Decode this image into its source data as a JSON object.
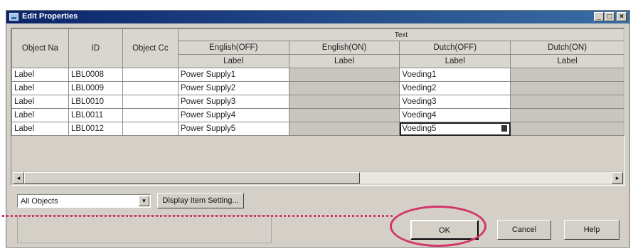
{
  "window": {
    "title": "Edit Properties"
  },
  "titlebar_buttons": [
    "_",
    "□",
    "×"
  ],
  "grid": {
    "col_object_name": "Object Na",
    "col_id": "ID",
    "col_object_comment": "Object Cc",
    "group_text": "Text",
    "lang_headers": [
      "English(OFF)",
      "English(ON)",
      "Dutch(OFF)",
      "Dutch(ON)"
    ],
    "sub_label": "Label",
    "rows": [
      {
        "type": "Label",
        "id": "LBL0008",
        "en_off": "Power Supply1",
        "nl_off": "Voeding1"
      },
      {
        "type": "Label",
        "id": "LBL0009",
        "en_off": "Power Supply2",
        "nl_off": "Voeding2"
      },
      {
        "type": "Label",
        "id": "LBL0010",
        "en_off": "Power Supply3",
        "nl_off": "Voeding3"
      },
      {
        "type": "Label",
        "id": "LBL0011",
        "en_off": "Power Supply4",
        "nl_off": "Voeding4"
      },
      {
        "type": "Label",
        "id": "LBL0012",
        "en_off": "Power Supply5",
        "nl_off": "Voeding5"
      }
    ]
  },
  "scroll": {
    "left": "◂",
    "right": "▸"
  },
  "filter": {
    "selected": "All Objects"
  },
  "buttons": {
    "display_item_setting": "Display Item Setting...",
    "ok": "OK",
    "cancel": "Cancel",
    "help": "Help"
  },
  "accent": "#d3366b"
}
